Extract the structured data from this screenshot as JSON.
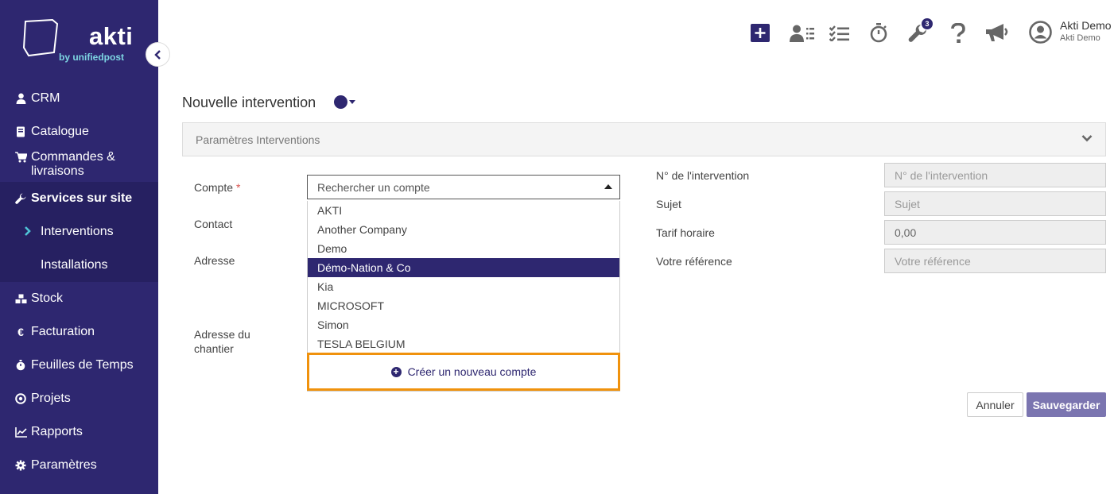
{
  "brand": {
    "name": "akti",
    "byline": "by unifiedpost"
  },
  "sidebar": {
    "items": [
      {
        "label": "CRM",
        "icon": "user-icon"
      },
      {
        "label": "Catalogue",
        "icon": "book-icon"
      },
      {
        "label": "Commandes & livraisons",
        "icon": "cart-icon"
      },
      {
        "label": "Services sur site",
        "icon": "wrench-icon"
      },
      {
        "label": "Stock",
        "icon": "cubes-icon"
      },
      {
        "label": "Facturation",
        "icon": "euro-icon"
      },
      {
        "label": "Feuilles de Temps",
        "icon": "stopwatch-icon"
      },
      {
        "label": "Projets",
        "icon": "target-icon"
      },
      {
        "label": "Rapports",
        "icon": "chart-icon"
      },
      {
        "label": "Paramètres",
        "icon": "gear-icon"
      }
    ],
    "subitems": [
      {
        "label": "Interventions"
      },
      {
        "label": "Installations"
      }
    ]
  },
  "topbar": {
    "notification_count": "3",
    "user_name": "Akti Demo",
    "user_company": "Akti Demo"
  },
  "page": {
    "title": "Nouvelle intervention",
    "status_color": "#2e2770"
  },
  "panel": {
    "title": "Paramètres Interventions"
  },
  "form": {
    "compte_label": "Compte",
    "required_mark": "*",
    "contact_label": "Contact",
    "adresse_label": "Adresse",
    "adresse_chantier_label": "Adresse du chantier",
    "compte_placeholder": "Rechercher un compte",
    "dropdown_options": [
      "AKTI",
      "Another Company",
      "Demo",
      "Démo-Nation & Co",
      "Kia",
      "MICROSOFT",
      "Simon",
      "TESLA BELGIUM"
    ],
    "highlighted_option": "Démo-Nation & Co",
    "create_account_label": "Créer un nouveau compte"
  },
  "right_form": {
    "intervention_no_label": "N° de l'intervention",
    "intervention_no_placeholder": "N° de l'intervention",
    "sujet_label": "Sujet",
    "sujet_placeholder": "Sujet",
    "tarif_label": "Tarif horaire",
    "tarif_value": "0,00",
    "reference_label": "Votre référence",
    "reference_placeholder": "Votre référence"
  },
  "actions": {
    "cancel": "Annuler",
    "save": "Sauvegarder"
  },
  "colors": {
    "primary": "#2e2770",
    "highlight_border": "#f0920d",
    "save_button": "#7b75b0"
  }
}
